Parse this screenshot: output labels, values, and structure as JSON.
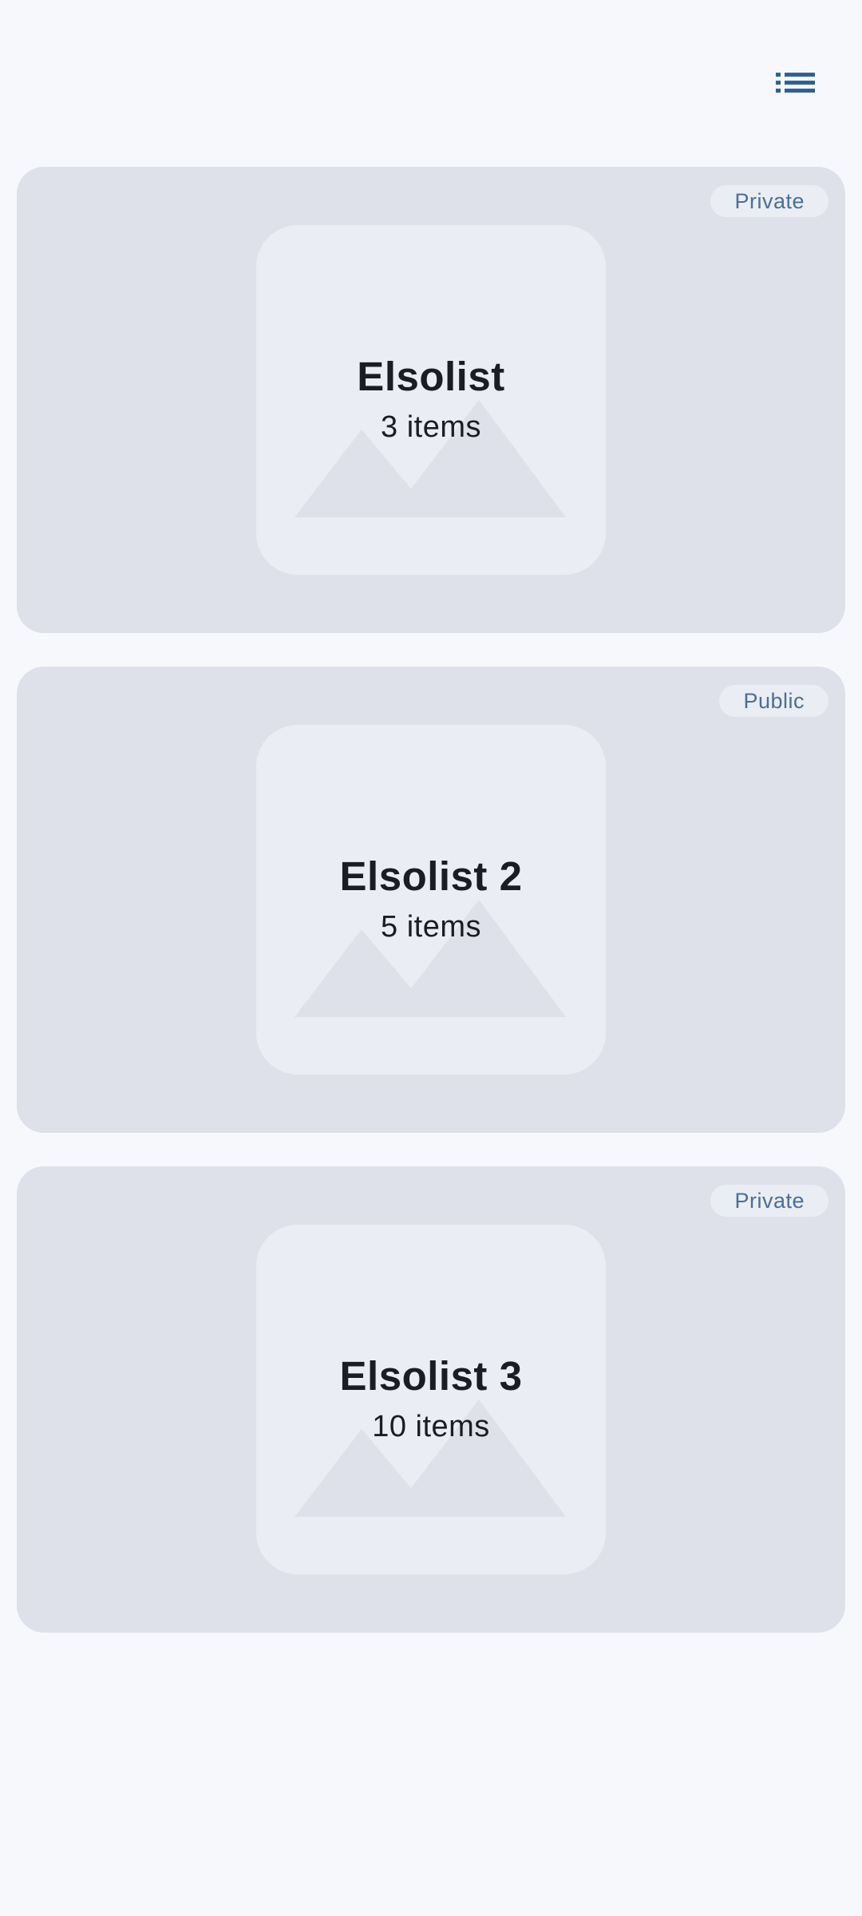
{
  "header": {
    "list_view_icon": "list-icon",
    "accent_color": "#2f6199"
  },
  "lists": [
    {
      "title": "Elsolist",
      "count": "3 items",
      "visibility": "Private"
    },
    {
      "title": "Elsolist 2",
      "count": "5 items",
      "visibility": "Public"
    },
    {
      "title": "Elsolist 3",
      "count": "10 items",
      "visibility": "Private"
    }
  ],
  "colors": {
    "background": "#f7f8fc",
    "card": "#dee1ea",
    "thumbnail": "#eaedf3",
    "badge_text": "#4a6f96",
    "title_text": "#1a1d21"
  }
}
